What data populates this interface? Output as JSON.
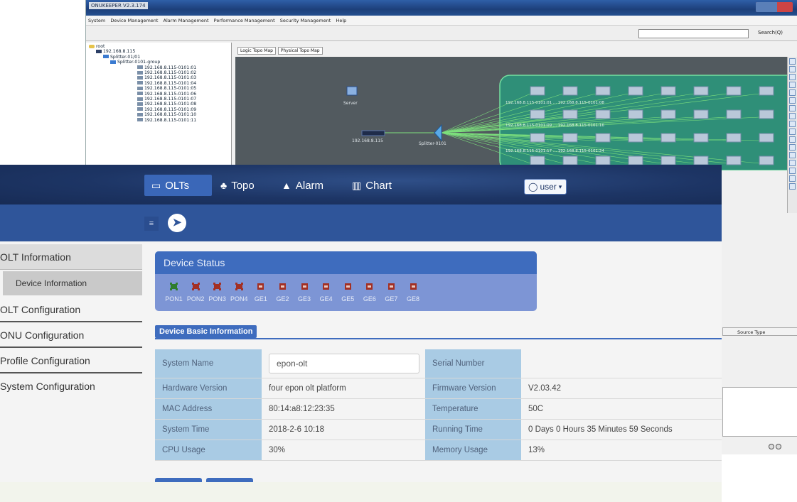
{
  "background_app": {
    "title": "ONUKEEPER V2.3.174",
    "menu": [
      "System",
      "Device Management",
      "Alarm Management",
      "Performance Management",
      "Security Management",
      "Help"
    ],
    "search_button": "Search(Q)",
    "tree": [
      {
        "label": "root",
        "indent": 0,
        "kind": "folder"
      },
      {
        "label": "192.168.8.115",
        "indent": 1,
        "kind": "dev"
      },
      {
        "label": "Splitter-01/01",
        "indent": 2,
        "kind": "split"
      },
      {
        "label": "Splitter-0101-group",
        "indent": 3,
        "kind": "split"
      },
      {
        "label": "192.168.8.115-0101:01",
        "indent": 4,
        "kind": "onu"
      },
      {
        "label": "192.168.8.115-0101:02",
        "indent": 4,
        "kind": "onu"
      },
      {
        "label": "192.168.8.115-0101:03",
        "indent": 4,
        "kind": "onu"
      },
      {
        "label": "192.168.8.115-0101:04",
        "indent": 4,
        "kind": "onu"
      },
      {
        "label": "192.168.8.115-0101:05",
        "indent": 4,
        "kind": "onu"
      },
      {
        "label": "192.168.8.115-0101:06",
        "indent": 4,
        "kind": "onu"
      },
      {
        "label": "192.168.8.115-0101:07",
        "indent": 4,
        "kind": "onu"
      },
      {
        "label": "192.168.8.115-0101:08",
        "indent": 4,
        "kind": "onu"
      },
      {
        "label": "192.168.8.115-0101:09",
        "indent": 4,
        "kind": "onu"
      },
      {
        "label": "192.168.8.115-0101:10",
        "indent": 4,
        "kind": "onu"
      },
      {
        "label": "192.168.8.115-0101:11",
        "indent": 4,
        "kind": "onu"
      }
    ],
    "tabs": [
      "Logic Topo Map",
      "Physical Topo Map"
    ],
    "topo": {
      "server_label": "Server",
      "olt_label": "192.168.8.115",
      "splitter_label": "Splitter-0101",
      "onu_row_labels": [
        "192.168.8.115-0101:01 ... 192.168.8.115-0101:08",
        "192.168.8.115-0101:09 ... 192.168.8.115-0101:16",
        "192.168.8.115-0101:17 ... 192.168.8.115-0101:24"
      ]
    },
    "source_type_header": "Source Type"
  },
  "nav": {
    "items": [
      {
        "label": "OLTs",
        "icon": "monitor-icon",
        "glyph": "▭"
      },
      {
        "label": "Topo",
        "icon": "topology-icon",
        "glyph": "♣"
      },
      {
        "label": "Alarm",
        "icon": "alarm-warning-icon",
        "glyph": "▲"
      },
      {
        "label": "Chart",
        "icon": "bar-chart-icon",
        "glyph": "▥"
      }
    ],
    "user_label": "user",
    "user_caret": "▾"
  },
  "sidebar": {
    "items": [
      {
        "label": "OLT Information"
      },
      {
        "label": "Device Information"
      },
      {
        "label": "OLT Configuration"
      },
      {
        "label": "ONU Configuration"
      },
      {
        "label": "Profile Configuration"
      },
      {
        "label": "System Configuration"
      }
    ]
  },
  "device_status": {
    "title": "Device Status",
    "ports": [
      {
        "label": "PON1",
        "type": "pon",
        "color": "#2e7d2e"
      },
      {
        "label": "PON2",
        "type": "pon",
        "color": "#a33024"
      },
      {
        "label": "PON3",
        "type": "pon",
        "color": "#a33024"
      },
      {
        "label": "PON4",
        "type": "pon",
        "color": "#a33024"
      },
      {
        "label": "GE1",
        "type": "ge",
        "color": "#a33024"
      },
      {
        "label": "GE2",
        "type": "ge",
        "color": "#a33024"
      },
      {
        "label": "GE3",
        "type": "ge",
        "color": "#a33024"
      },
      {
        "label": "GE4",
        "type": "ge",
        "color": "#a33024"
      },
      {
        "label": "GE5",
        "type": "ge",
        "color": "#a33024"
      },
      {
        "label": "GE6",
        "type": "ge",
        "color": "#a33024"
      },
      {
        "label": "GE7",
        "type": "ge",
        "color": "#a33024"
      },
      {
        "label": "GE8",
        "type": "ge",
        "color": "#a33024"
      }
    ]
  },
  "basic_info": {
    "title": "Device Basic Information",
    "rows": [
      {
        "k1": "System Name",
        "v1": "epon-olt",
        "k2": "Serial Number",
        "v2": ""
      },
      {
        "k1": "Hardware Version",
        "v1": "four epon olt platform",
        "k2": "Firmware Version",
        "v2": "V2.03.42"
      },
      {
        "k1": "MAC Address",
        "v1": "80:14:a8:12:23:35",
        "k2": "Temperature",
        "v2": "50C"
      },
      {
        "k1": "System Time",
        "v1": "2018-2-6 10:18",
        "k2": "Running Time",
        "v2": "0 Days 0 Hours 35 Minutes 59 Seconds"
      },
      {
        "k1": "CPU Usage",
        "v1": "30%",
        "k2": "Memory Usage",
        "v2": "13%"
      }
    ]
  },
  "colors": {
    "nav_bg": "#1d3565",
    "sub_bg": "#2f559a",
    "accent": "#3e6cbe",
    "port_up": "#2e7d2e",
    "port_down": "#a33024",
    "table_key_bg": "#a9cbe4"
  }
}
